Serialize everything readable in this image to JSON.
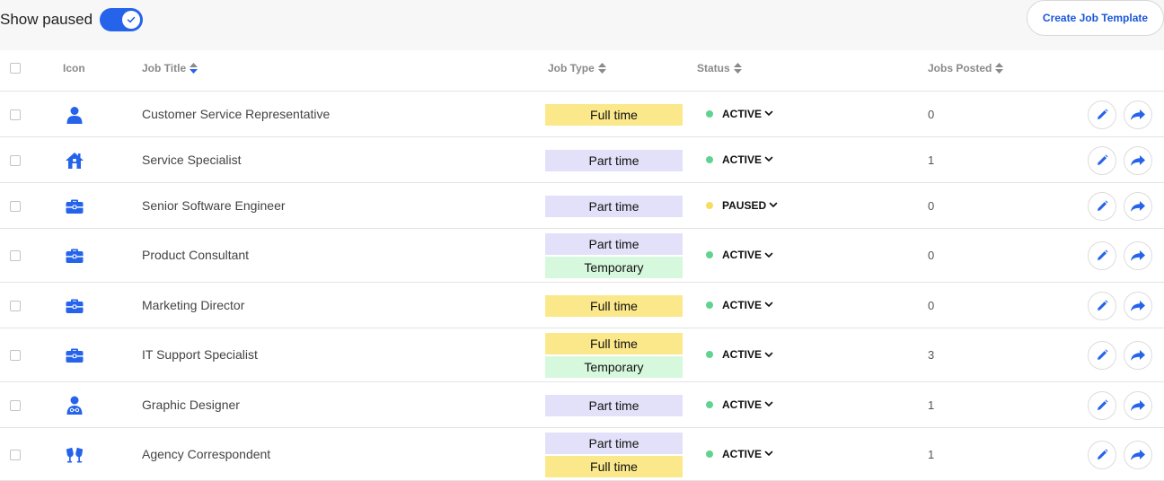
{
  "toolbar": {
    "show_paused_label": "Show paused",
    "show_paused_on": true,
    "create_button_label": "Create Job Template"
  },
  "columns": {
    "icon": "Icon",
    "job_title": "Job Title",
    "job_type": "Job Type",
    "status": "Status",
    "jobs_posted": "Jobs Posted"
  },
  "colors": {
    "accent": "#2563eb",
    "active": "#5fd38f",
    "paused": "#f7dc5f",
    "full_time": "#fbe88a",
    "part_time": "#e3e1f9",
    "temporary": "#d6f8dd"
  },
  "rows": [
    {
      "icon": "person-icon",
      "title": "Customer Service Representative",
      "types": [
        "Full time"
      ],
      "status": "ACTIVE",
      "jobs_posted": "0"
    },
    {
      "icon": "house-icon",
      "title": "Service Specialist",
      "types": [
        "Part time"
      ],
      "status": "ACTIVE",
      "jobs_posted": "1"
    },
    {
      "icon": "briefcase-icon",
      "title": "Senior Software Engineer",
      "types": [
        "Part time"
      ],
      "status": "PAUSED",
      "jobs_posted": "0"
    },
    {
      "icon": "briefcase-icon",
      "title": "Product Consultant",
      "types": [
        "Part time",
        "Temporary"
      ],
      "status": "ACTIVE",
      "jobs_posted": "0"
    },
    {
      "icon": "briefcase-icon",
      "title": "Marketing Director",
      "types": [
        "Full time"
      ],
      "status": "ACTIVE",
      "jobs_posted": "0"
    },
    {
      "icon": "briefcase-icon",
      "title": "IT Support Specialist",
      "types": [
        "Full time",
        "Temporary"
      ],
      "status": "ACTIVE",
      "jobs_posted": "3"
    },
    {
      "icon": "user-glasses-icon",
      "title": "Graphic Designer",
      "types": [
        "Part time"
      ],
      "status": "ACTIVE",
      "jobs_posted": "1"
    },
    {
      "icon": "cheers-icon",
      "title": "Agency Correspondent",
      "types": [
        "Part time",
        "Full time"
      ],
      "status": "ACTIVE",
      "jobs_posted": "1"
    }
  ]
}
